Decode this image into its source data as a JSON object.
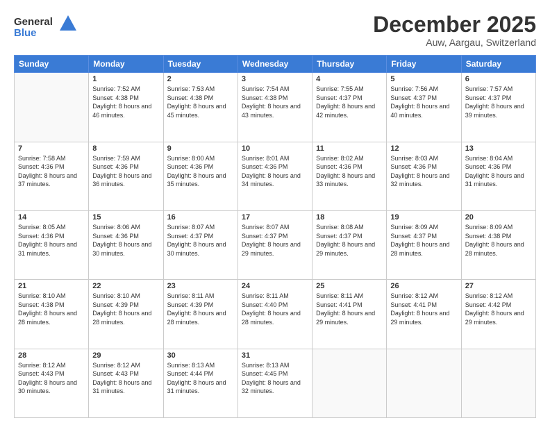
{
  "header": {
    "logo_general": "General",
    "logo_blue": "Blue",
    "month_title": "December 2025",
    "location": "Auw, Aargau, Switzerland"
  },
  "weekdays": [
    "Sunday",
    "Monday",
    "Tuesday",
    "Wednesday",
    "Thursday",
    "Friday",
    "Saturday"
  ],
  "weeks": [
    [
      {
        "day": "",
        "sunrise": "",
        "sunset": "",
        "daylight": ""
      },
      {
        "day": "1",
        "sunrise": "Sunrise: 7:52 AM",
        "sunset": "Sunset: 4:38 PM",
        "daylight": "Daylight: 8 hours and 46 minutes."
      },
      {
        "day": "2",
        "sunrise": "Sunrise: 7:53 AM",
        "sunset": "Sunset: 4:38 PM",
        "daylight": "Daylight: 8 hours and 45 minutes."
      },
      {
        "day": "3",
        "sunrise": "Sunrise: 7:54 AM",
        "sunset": "Sunset: 4:38 PM",
        "daylight": "Daylight: 8 hours and 43 minutes."
      },
      {
        "day": "4",
        "sunrise": "Sunrise: 7:55 AM",
        "sunset": "Sunset: 4:37 PM",
        "daylight": "Daylight: 8 hours and 42 minutes."
      },
      {
        "day": "5",
        "sunrise": "Sunrise: 7:56 AM",
        "sunset": "Sunset: 4:37 PM",
        "daylight": "Daylight: 8 hours and 40 minutes."
      },
      {
        "day": "6",
        "sunrise": "Sunrise: 7:57 AM",
        "sunset": "Sunset: 4:37 PM",
        "daylight": "Daylight: 8 hours and 39 minutes."
      }
    ],
    [
      {
        "day": "7",
        "sunrise": "Sunrise: 7:58 AM",
        "sunset": "Sunset: 4:36 PM",
        "daylight": "Daylight: 8 hours and 37 minutes."
      },
      {
        "day": "8",
        "sunrise": "Sunrise: 7:59 AM",
        "sunset": "Sunset: 4:36 PM",
        "daylight": "Daylight: 8 hours and 36 minutes."
      },
      {
        "day": "9",
        "sunrise": "Sunrise: 8:00 AM",
        "sunset": "Sunset: 4:36 PM",
        "daylight": "Daylight: 8 hours and 35 minutes."
      },
      {
        "day": "10",
        "sunrise": "Sunrise: 8:01 AM",
        "sunset": "Sunset: 4:36 PM",
        "daylight": "Daylight: 8 hours and 34 minutes."
      },
      {
        "day": "11",
        "sunrise": "Sunrise: 8:02 AM",
        "sunset": "Sunset: 4:36 PM",
        "daylight": "Daylight: 8 hours and 33 minutes."
      },
      {
        "day": "12",
        "sunrise": "Sunrise: 8:03 AM",
        "sunset": "Sunset: 4:36 PM",
        "daylight": "Daylight: 8 hours and 32 minutes."
      },
      {
        "day": "13",
        "sunrise": "Sunrise: 8:04 AM",
        "sunset": "Sunset: 4:36 PM",
        "daylight": "Daylight: 8 hours and 31 minutes."
      }
    ],
    [
      {
        "day": "14",
        "sunrise": "Sunrise: 8:05 AM",
        "sunset": "Sunset: 4:36 PM",
        "daylight": "Daylight: 8 hours and 31 minutes."
      },
      {
        "day": "15",
        "sunrise": "Sunrise: 8:06 AM",
        "sunset": "Sunset: 4:36 PM",
        "daylight": "Daylight: 8 hours and 30 minutes."
      },
      {
        "day": "16",
        "sunrise": "Sunrise: 8:07 AM",
        "sunset": "Sunset: 4:37 PM",
        "daylight": "Daylight: 8 hours and 30 minutes."
      },
      {
        "day": "17",
        "sunrise": "Sunrise: 8:07 AM",
        "sunset": "Sunset: 4:37 PM",
        "daylight": "Daylight: 8 hours and 29 minutes."
      },
      {
        "day": "18",
        "sunrise": "Sunrise: 8:08 AM",
        "sunset": "Sunset: 4:37 PM",
        "daylight": "Daylight: 8 hours and 29 minutes."
      },
      {
        "day": "19",
        "sunrise": "Sunrise: 8:09 AM",
        "sunset": "Sunset: 4:37 PM",
        "daylight": "Daylight: 8 hours and 28 minutes."
      },
      {
        "day": "20",
        "sunrise": "Sunrise: 8:09 AM",
        "sunset": "Sunset: 4:38 PM",
        "daylight": "Daylight: 8 hours and 28 minutes."
      }
    ],
    [
      {
        "day": "21",
        "sunrise": "Sunrise: 8:10 AM",
        "sunset": "Sunset: 4:38 PM",
        "daylight": "Daylight: 8 hours and 28 minutes."
      },
      {
        "day": "22",
        "sunrise": "Sunrise: 8:10 AM",
        "sunset": "Sunset: 4:39 PM",
        "daylight": "Daylight: 8 hours and 28 minutes."
      },
      {
        "day": "23",
        "sunrise": "Sunrise: 8:11 AM",
        "sunset": "Sunset: 4:39 PM",
        "daylight": "Daylight: 8 hours and 28 minutes."
      },
      {
        "day": "24",
        "sunrise": "Sunrise: 8:11 AM",
        "sunset": "Sunset: 4:40 PM",
        "daylight": "Daylight: 8 hours and 28 minutes."
      },
      {
        "day": "25",
        "sunrise": "Sunrise: 8:11 AM",
        "sunset": "Sunset: 4:41 PM",
        "daylight": "Daylight: 8 hours and 29 minutes."
      },
      {
        "day": "26",
        "sunrise": "Sunrise: 8:12 AM",
        "sunset": "Sunset: 4:41 PM",
        "daylight": "Daylight: 8 hours and 29 minutes."
      },
      {
        "day": "27",
        "sunrise": "Sunrise: 8:12 AM",
        "sunset": "Sunset: 4:42 PM",
        "daylight": "Daylight: 8 hours and 29 minutes."
      }
    ],
    [
      {
        "day": "28",
        "sunrise": "Sunrise: 8:12 AM",
        "sunset": "Sunset: 4:43 PM",
        "daylight": "Daylight: 8 hours and 30 minutes."
      },
      {
        "day": "29",
        "sunrise": "Sunrise: 8:12 AM",
        "sunset": "Sunset: 4:43 PM",
        "daylight": "Daylight: 8 hours and 31 minutes."
      },
      {
        "day": "30",
        "sunrise": "Sunrise: 8:13 AM",
        "sunset": "Sunset: 4:44 PM",
        "daylight": "Daylight: 8 hours and 31 minutes."
      },
      {
        "day": "31",
        "sunrise": "Sunrise: 8:13 AM",
        "sunset": "Sunset: 4:45 PM",
        "daylight": "Daylight: 8 hours and 32 minutes."
      },
      {
        "day": "",
        "sunrise": "",
        "sunset": "",
        "daylight": ""
      },
      {
        "day": "",
        "sunrise": "",
        "sunset": "",
        "daylight": ""
      },
      {
        "day": "",
        "sunrise": "",
        "sunset": "",
        "daylight": ""
      }
    ]
  ]
}
